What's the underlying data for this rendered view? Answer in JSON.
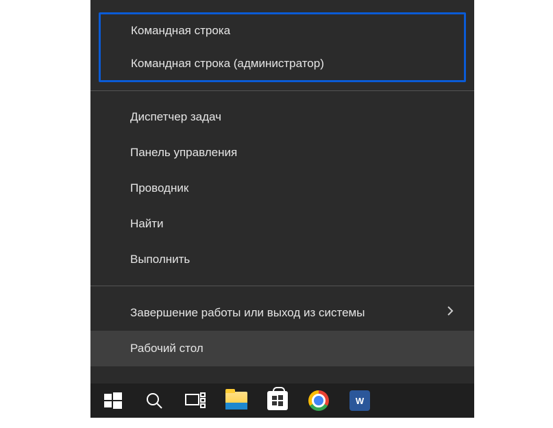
{
  "menu": {
    "highlight": [
      {
        "label": "Командная строка"
      },
      {
        "label": "Командная строка (администратор)"
      }
    ],
    "group1": [
      {
        "label": "Диспетчер задач"
      },
      {
        "label": "Панель управления"
      },
      {
        "label": "Проводник"
      },
      {
        "label": "Найти"
      },
      {
        "label": "Выполнить"
      }
    ],
    "group2": [
      {
        "label": "Завершение работы или выход из системы",
        "submenu": true
      },
      {
        "label": "Рабочий стол",
        "hovered": true
      }
    ]
  },
  "taskbar": {
    "items": [
      {
        "name": "start-button",
        "icon": "windows-logo-icon"
      },
      {
        "name": "search-button",
        "icon": "search-icon"
      },
      {
        "name": "task-view-button",
        "icon": "task-view-icon"
      },
      {
        "name": "file-explorer-button",
        "icon": "explorer-icon"
      },
      {
        "name": "store-button",
        "icon": "store-icon"
      },
      {
        "name": "chrome-button",
        "icon": "chrome-icon"
      },
      {
        "name": "word-button",
        "icon": "word-icon",
        "badge": "W"
      }
    ]
  }
}
